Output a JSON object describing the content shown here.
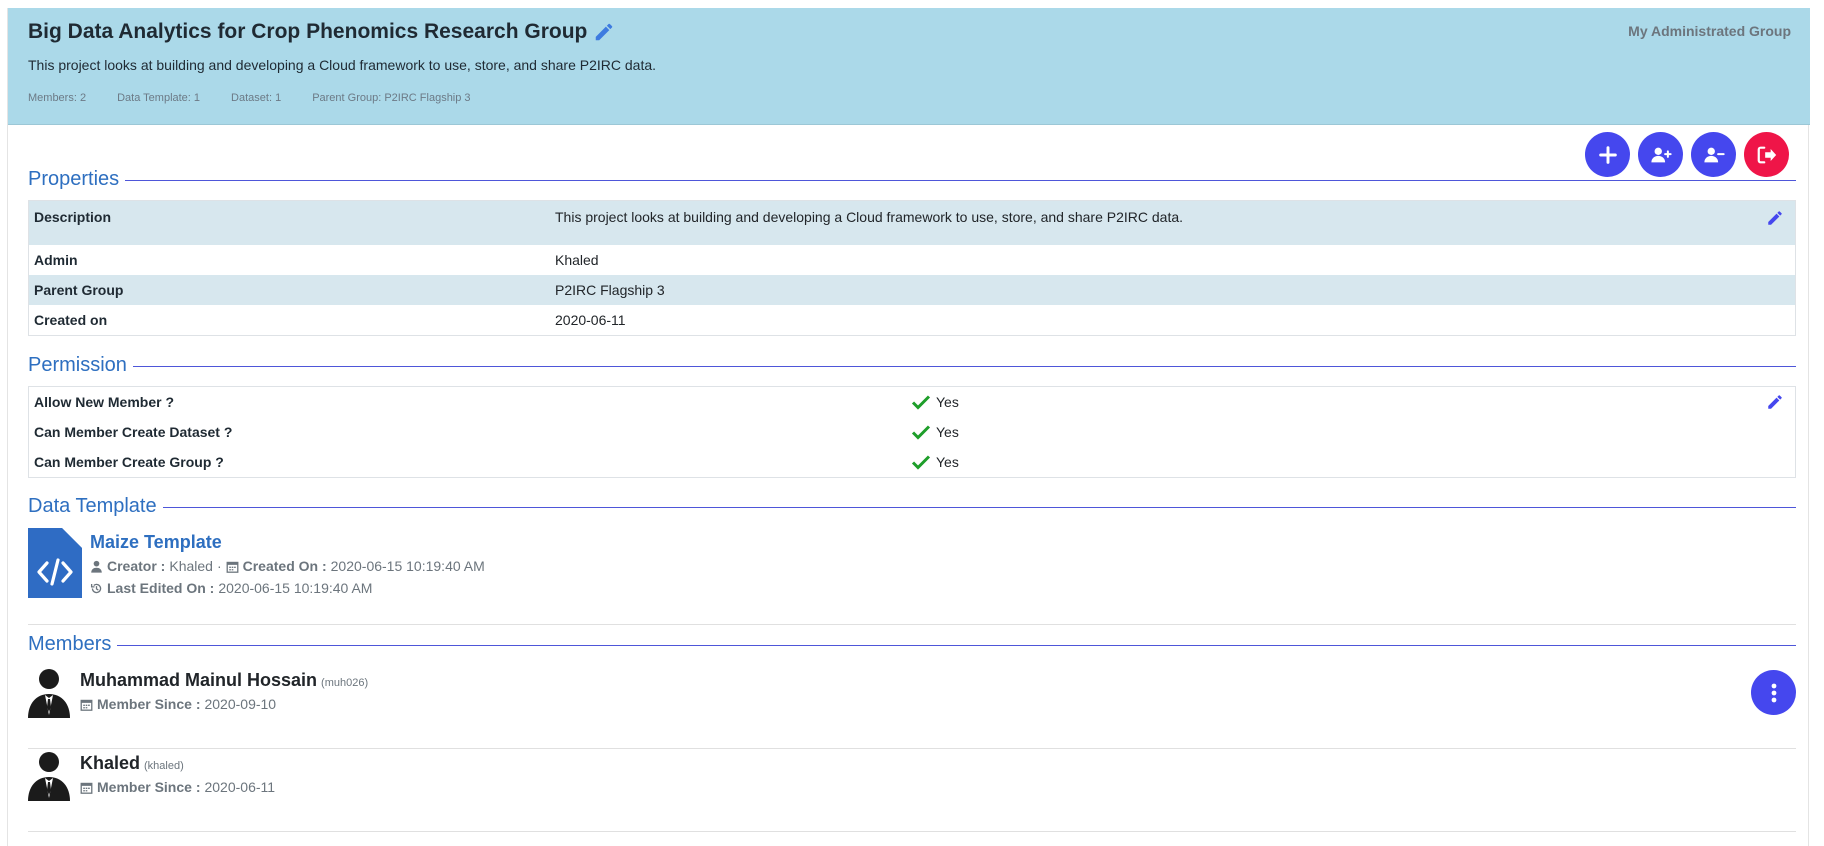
{
  "header": {
    "title": "Big Data Analytics for Crop Phenomics Research Group",
    "description": "This project looks at building and developing a Cloud framework to use, store, and share P2IRC data.",
    "stats": [
      "Members: 2",
      "Data Template: 1",
      "Dataset: 1",
      "Parent Group: P2IRC Flagship 3"
    ],
    "badge": "My Administrated Group"
  },
  "actions": [
    {
      "name": "add-button",
      "icon": "plus-icon"
    },
    {
      "name": "add-member-button",
      "icon": "user-plus-icon"
    },
    {
      "name": "remove-member-button",
      "icon": "user-minus-icon"
    },
    {
      "name": "leave-group-button",
      "icon": "sign-out-icon"
    }
  ],
  "properties": {
    "heading": "Properties",
    "rows": [
      {
        "key": "Description",
        "value": "This project looks at building and developing a Cloud framework to use, store, and share P2IRC data."
      },
      {
        "key": "Admin",
        "value": "Khaled"
      },
      {
        "key": "Parent Group",
        "value": "P2IRC Flagship 3"
      },
      {
        "key": "Created on",
        "value": "2020-06-11"
      }
    ]
  },
  "permission": {
    "heading": "Permission",
    "rows": [
      {
        "key": "Allow New Member ?",
        "value": "Yes"
      },
      {
        "key": "Can Member Create Dataset ?",
        "value": "Yes"
      },
      {
        "key": "Can Member Create Group ?",
        "value": "Yes"
      }
    ]
  },
  "data_template": {
    "heading": "Data Template",
    "name": "Maize Template",
    "creator_label": "Creator :",
    "creator": "Khaled",
    "separator": "·",
    "created_label": "Created On :",
    "created": "2020-06-15 10:19:40 AM",
    "edited_label": "Last Edited On :",
    "edited": "2020-06-15 10:19:40 AM"
  },
  "members": {
    "heading": "Members",
    "since_label": "Member Since :",
    "items": [
      {
        "name": "Muhammad Mainul Hossain",
        "username": "(muh026)",
        "since": "2020-09-10"
      },
      {
        "name": "Khaled",
        "username": "(khaled)",
        "since": "2020-06-11"
      }
    ]
  },
  "colors": {
    "banner": "#abd9e9",
    "accent": "#4547ee",
    "danger": "#ef1548",
    "heading": "#2e6fc0",
    "check": "#1e9e2a"
  }
}
